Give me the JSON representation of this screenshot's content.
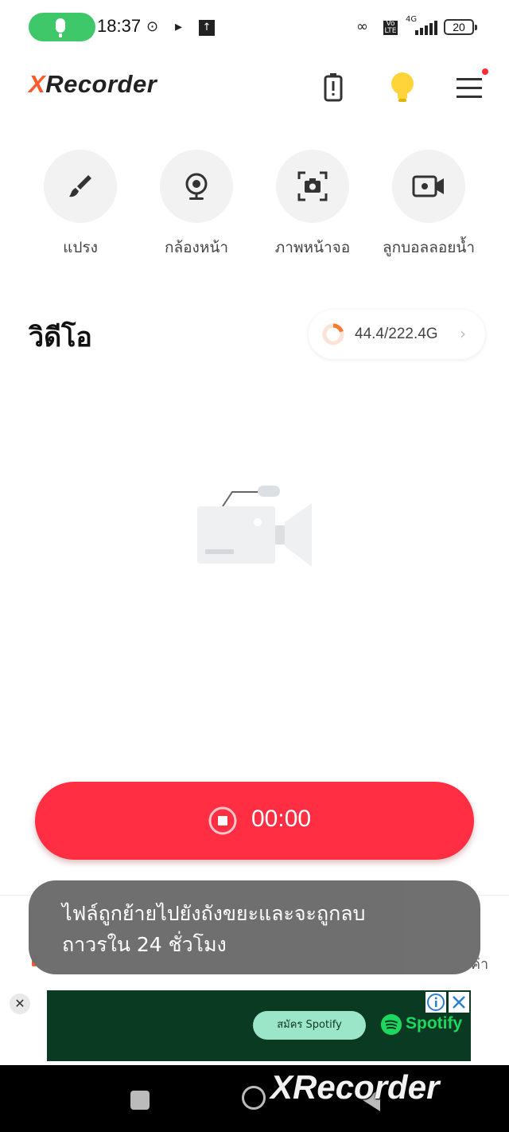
{
  "status_bar": {
    "time": "18:37",
    "network": "4G",
    "volte": "Vo LTE",
    "battery": "20"
  },
  "header": {
    "logo_x": "X",
    "logo_rest": "Recorder",
    "icons": [
      "battery-saver-icon",
      "lightbulb-icon",
      "menu-icon"
    ],
    "notification_dot_color": "#ff2d2d"
  },
  "tools": [
    {
      "label": "แปรง",
      "icon": "brush-icon"
    },
    {
      "label": "กล้องหน้า",
      "icon": "webcam-icon"
    },
    {
      "label": "ภาพหน้าจอ",
      "icon": "screenshot-icon"
    },
    {
      "label": "ลูกบอลลอยน้ำ",
      "icon": "floating-ball-icon"
    }
  ],
  "section": {
    "title": "วิดีโอ",
    "storage": "44.4/222.4G",
    "storage_used_fraction": 0.2
  },
  "record": {
    "time": "00:00",
    "color": "#ff2e42"
  },
  "toast": {
    "line1": "ไฟล์ถูกย้ายไปยังถังขยะและจะถูกลบ",
    "line2": "ถาวรใน 24 ชั่วโมง"
  },
  "bottom_tabs": {
    "right_partial": "ค่า"
  },
  "ad": {
    "cta": "สมัคร Spotify",
    "brand": "Spotify",
    "close": "✕"
  },
  "watermark": "XRecorder",
  "colors": {
    "accent": "#ff5a2b",
    "record_red": "#ff2e42",
    "mic_green": "#3fc86a",
    "spotify_green": "#1ed760"
  }
}
